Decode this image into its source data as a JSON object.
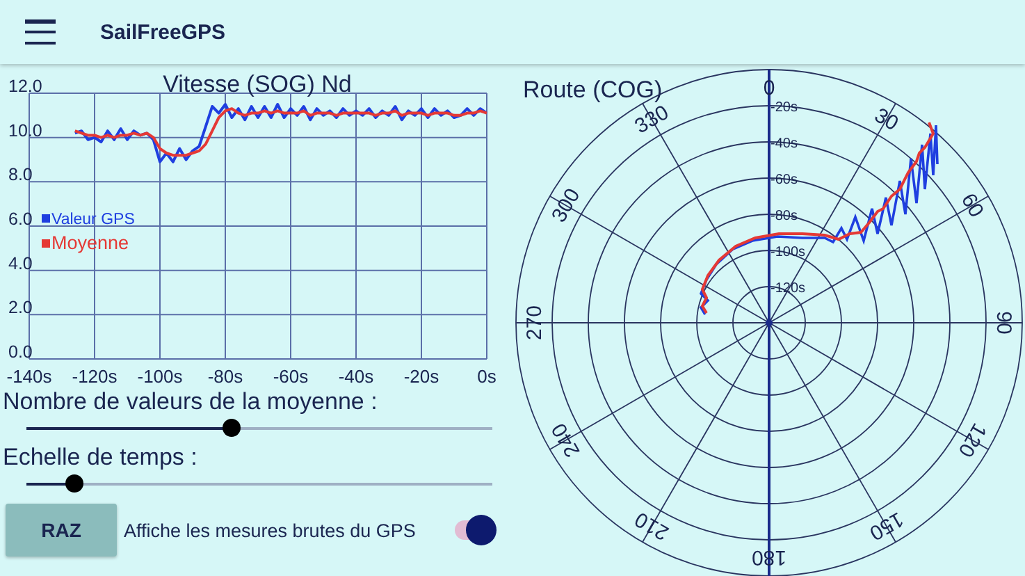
{
  "app_bar": {
    "title": "SailFreeGPS"
  },
  "speed_chart": {
    "chart_data": {
      "type": "line",
      "title": "Vitesse (SOG) Nd",
      "x": [
        -126,
        -124,
        -122,
        -120,
        -118,
        -116,
        -114,
        -112,
        -110,
        -108,
        -106,
        -104,
        -102,
        -100,
        -98,
        -96,
        -94,
        -92,
        -90,
        -88,
        -86,
        -84,
        -82,
        -80,
        -78,
        -76,
        -74,
        -72,
        -70,
        -68,
        -66,
        -64,
        -62,
        -60,
        -58,
        -56,
        -54,
        -52,
        -50,
        -48,
        -46,
        -44,
        -42,
        -40,
        -38,
        -36,
        -34,
        -32,
        -30,
        -28,
        -26,
        -24,
        -22,
        -20,
        -18,
        -16,
        -14,
        -12,
        -10,
        -8,
        -6,
        -4,
        -2,
        0
      ],
      "series": [
        {
          "name": "Valeur GPS",
          "color": "#1f3fe0",
          "values": [
            10.2,
            10.3,
            9.9,
            10.0,
            9.8,
            10.3,
            9.9,
            10.4,
            9.9,
            10.3,
            10.1,
            10.2,
            9.9,
            8.9,
            9.3,
            8.9,
            9.5,
            9.0,
            9.4,
            9.6,
            10.5,
            11.4,
            11.1,
            11.5,
            10.9,
            11.3,
            10.8,
            11.4,
            10.9,
            11.4,
            10.9,
            11.5,
            10.9,
            11.3,
            11.0,
            11.4,
            10.8,
            11.3,
            11.0,
            11.2,
            10.9,
            11.3,
            11.0,
            11.2,
            11.0,
            11.3,
            10.9,
            11.2,
            11.0,
            11.4,
            10.8,
            11.2,
            11.0,
            11.3,
            10.9,
            11.3,
            11.0,
            11.2,
            10.9,
            11.0,
            11.3,
            11.0,
            11.3,
            11.1
          ]
        },
        {
          "name": "Moyenne",
          "color": "#e53935",
          "values": [
            10.3,
            10.2,
            10.1,
            10.1,
            10.0,
            10.1,
            10.0,
            10.1,
            10.1,
            10.2,
            10.1,
            10.2,
            10.0,
            9.5,
            9.3,
            9.2,
            9.2,
            9.2,
            9.3,
            9.4,
            9.7,
            10.3,
            10.9,
            11.2,
            11.3,
            11.1,
            11.0,
            11.1,
            11.1,
            11.2,
            11.1,
            11.2,
            11.1,
            11.1,
            11.1,
            11.2,
            11.0,
            11.1,
            11.1,
            11.1,
            11.0,
            11.1,
            11.1,
            11.1,
            11.1,
            11.1,
            11.0,
            11.1,
            11.1,
            11.2,
            11.0,
            11.1,
            11.1,
            11.1,
            11.0,
            11.1,
            11.1,
            11.1,
            11.0,
            11.0,
            11.1,
            11.1,
            11.2,
            11.1
          ]
        }
      ],
      "xlim": [
        -140,
        0
      ],
      "ylim": [
        0,
        12
      ],
      "grid": true,
      "legend": true,
      "xticks": [
        {
          "value": -140,
          "label": "-140s"
        },
        {
          "value": -120,
          "label": "-120s"
        },
        {
          "value": -100,
          "label": "-100s"
        },
        {
          "value": -80,
          "label": "-80s"
        },
        {
          "value": -60,
          "label": "-60s"
        },
        {
          "value": -40,
          "label": "-40s"
        },
        {
          "value": -20,
          "label": "-20s"
        },
        {
          "value": 0,
          "label": "0s"
        }
      ],
      "yticks": [
        {
          "value": 0,
          "label": "0.0"
        },
        {
          "value": 2,
          "label": "2.0"
        },
        {
          "value": 4,
          "label": "4.0"
        },
        {
          "value": 6,
          "label": "6.0"
        },
        {
          "value": 8,
          "label": "8.0"
        },
        {
          "value": 10,
          "label": "10.0"
        },
        {
          "value": 12,
          "label": "12.0"
        }
      ]
    }
  },
  "course_chart": {
    "title": "Route (COG)",
    "angle_labels": [
      "0",
      "30",
      "60",
      "90",
      "120",
      "150",
      "180",
      "210",
      "240",
      "270",
      "300",
      "330"
    ],
    "ring_labels": [
      "-20s",
      "-40s",
      "-60s",
      "-80s",
      "-100s",
      "-120s"
    ]
  },
  "sliders": [
    {
      "label": "Nombre de valeurs de la moyenne :",
      "level": 0.44
    },
    {
      "label": "Echelle de temps :",
      "level": 0.1
    }
  ],
  "reset_button": {
    "label": "RAZ"
  },
  "raw_toggle": {
    "label": "Affiche les mesures brutes du GPS",
    "on": true
  }
}
